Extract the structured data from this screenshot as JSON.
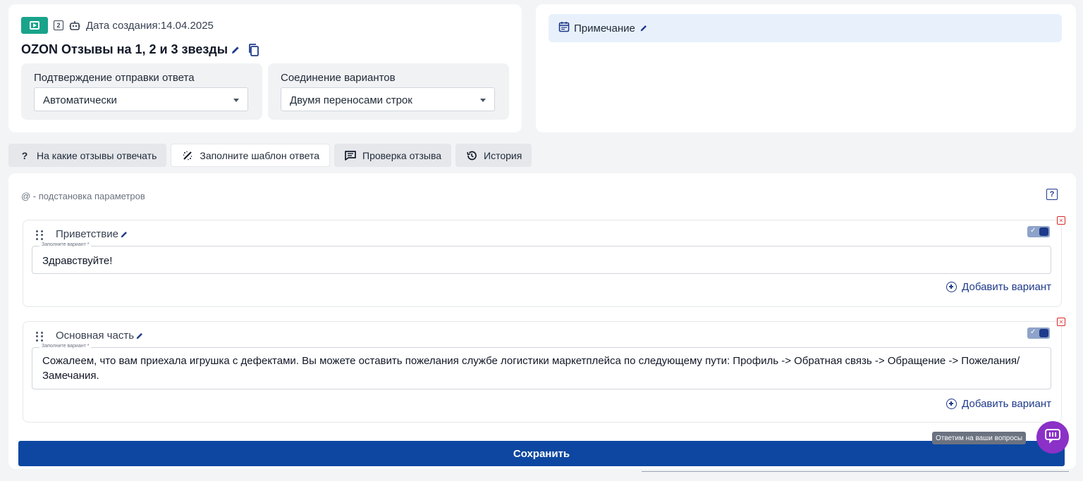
{
  "header": {
    "date_label": "Дата создания:14.04.2025",
    "title": "OZON Отзывы на 1, 2 и 3 звезды",
    "badge_icons": [
      "play-box-icon",
      "number-badge-icon",
      "robot-icon"
    ],
    "number_badge": "2"
  },
  "settings": {
    "confirm": {
      "label": "Подтверждение отправки ответа",
      "value": "Автоматически"
    },
    "join": {
      "label": "Соединение вариантов",
      "value": "Двумя переносами строк"
    }
  },
  "note": {
    "label": "Примечание"
  },
  "tabs": [
    {
      "label": "На какие отзывы отвечать",
      "icon": "question-icon",
      "active": false
    },
    {
      "label": "Заполните шаблон ответа",
      "icon": "magic-wand-icon",
      "active": true
    },
    {
      "label": "Проверка отзыва",
      "icon": "comment-icon",
      "active": false
    },
    {
      "label": "История",
      "icon": "history-icon",
      "active": false
    }
  ],
  "editor": {
    "hint": "@ - подстановка параметров",
    "help_icon_label": "?",
    "blocks": [
      {
        "title": "Приветствие",
        "field_label": "Заполните вариант *",
        "value": "Здравствуйте!",
        "enabled": true,
        "add_label": "Добавить вариант"
      },
      {
        "title": "Основная часть",
        "field_label": "Заполните вариант *",
        "value": "Сожалеем, что вам приехала игрушка с дефектами. Вы можете оставить пожелания службе логистики маркетплейса по следующему пути: Профиль -> Обратная связь -> Обращение -> Пожелания/Замечания.",
        "enabled": true,
        "add_label": "Добавить вариант"
      }
    ]
  },
  "save_label": "Сохранить",
  "chat": {
    "tooltip": "Ответим на ваши вопросы"
  },
  "colors": {
    "primary": "#0d47a1",
    "accent_green": "#19a38b",
    "chat_purple": "#8b31c7",
    "danger": "#dc2626",
    "note_bg": "#e8f1fb"
  }
}
